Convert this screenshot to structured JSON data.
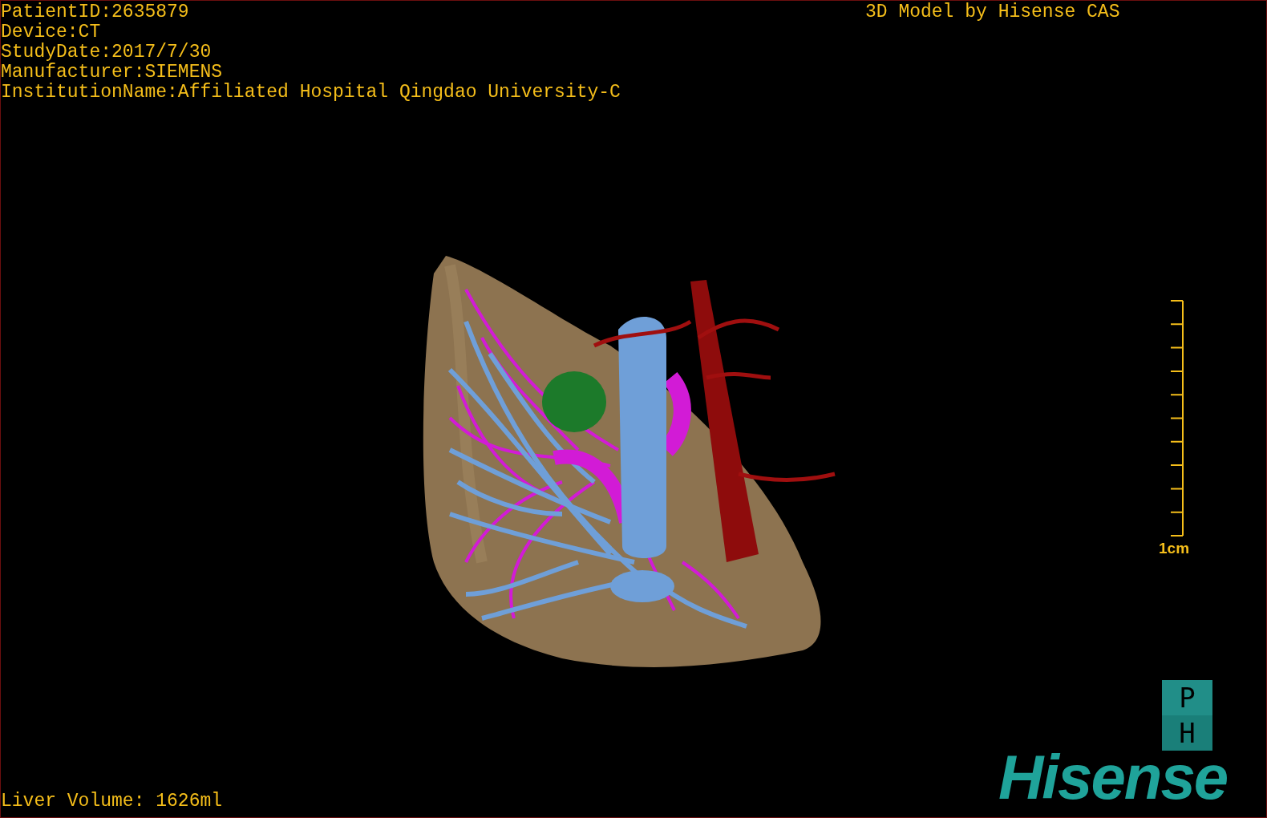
{
  "info_lines": [
    "PatientID:2635879",
    "Device:CT",
    "StudyDate:2017/7/30",
    "Manufacturer:SIEMENS",
    "InstitutionName:Affiliated Hospital Qingdao University-C"
  ],
  "model_credit": "3D Model by Hisense CAS",
  "scale_bar": {
    "label": "1cm"
  },
  "view_buttons": [
    "P",
    "H"
  ],
  "logo": "Hisense",
  "liver_volume": "Liver Volume: 1626ml"
}
